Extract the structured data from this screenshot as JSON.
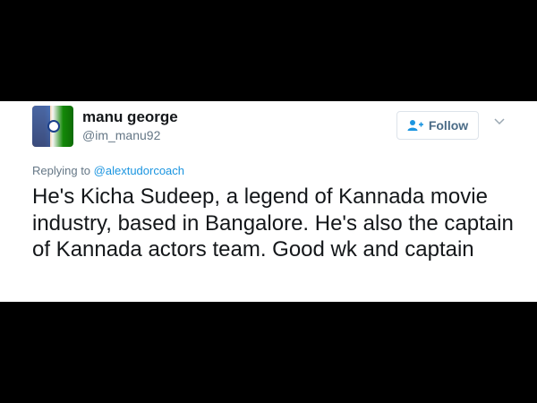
{
  "tweet": {
    "display_name": "manu george",
    "handle": "@im_manu92",
    "follow_label": "Follow",
    "replying_prefix": "Replying to ",
    "replying_to": "@alextudorcoach",
    "text": "He's Kicha Sudeep, a legend of Kannada movie industry, based in Bangalore. He's also the captain of Kannada actors team. Good wk and captain"
  },
  "icons": {
    "follow": "add-user-icon",
    "menu": "chevron-down-icon"
  },
  "colors": {
    "background": "#000000",
    "card": "#ffffff",
    "link": "#1b95e0",
    "secondary_text": "#657786",
    "follow_text": "#4a6b86"
  }
}
